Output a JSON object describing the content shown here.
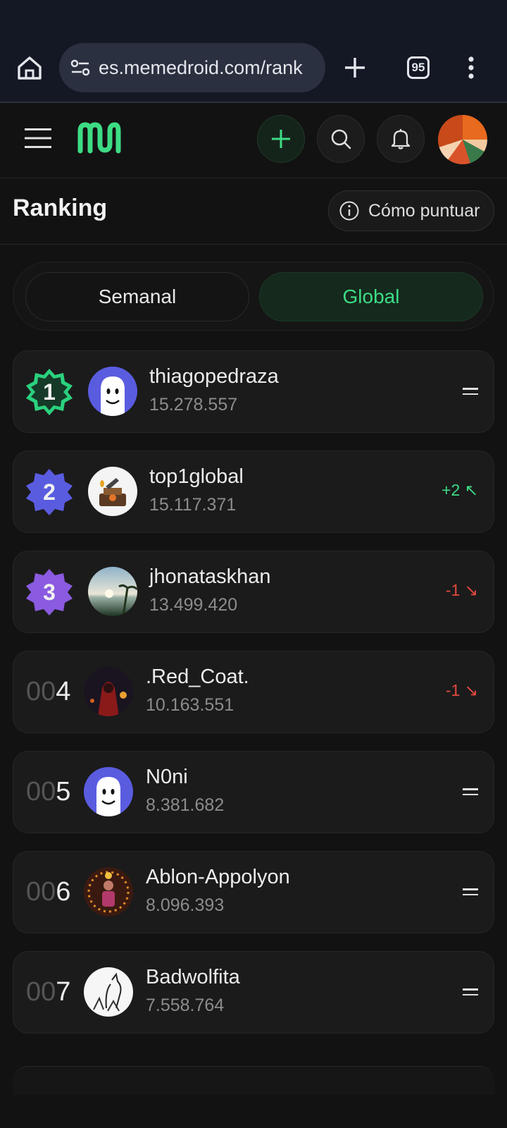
{
  "browser": {
    "url": "es.memedroid.com/rank",
    "tab_count": "95"
  },
  "colors": {
    "accent": "#3ddc84",
    "up": "#3ddc84",
    "down": "#e5483f",
    "gold_badge": "#2bd17e",
    "silver_badge": "#5a5ce0",
    "bronze_badge": "#8a5ae0"
  },
  "header": {
    "icons": [
      "menu-icon",
      "memedroid-logo",
      "plus-icon",
      "search-icon",
      "bell-icon",
      "user-avatar"
    ]
  },
  "page": {
    "title": "Ranking",
    "howto_label": "Cómo puntuar"
  },
  "tabs": {
    "weekly": "Semanal",
    "global": "Global",
    "selected": "Global"
  },
  "ranking": [
    {
      "rank": "1",
      "username": "thiagopedraza",
      "score": "15.278.557",
      "change": "=",
      "trend": "same"
    },
    {
      "rank": "2",
      "username": "top1global",
      "score": "15.117.371",
      "change": "+2 ↖",
      "trend": "up"
    },
    {
      "rank": "3",
      "username": "jhonataskhan",
      "score": "13.499.420",
      "change": "-1 ↘",
      "trend": "down"
    },
    {
      "rank_pad": "00",
      "rank": "4",
      "username": ".Red_Coat.",
      "score": "10.163.551",
      "change": "-1 ↘",
      "trend": "down"
    },
    {
      "rank_pad": "00",
      "rank": "5",
      "username": "N0ni",
      "score": "8.381.682",
      "change": "=",
      "trend": "same"
    },
    {
      "rank_pad": "00",
      "rank": "6",
      "username": "Ablon-Appolyon",
      "score": "8.096.393",
      "change": "=",
      "trend": "same"
    },
    {
      "rank_pad": "00",
      "rank": "7",
      "username": "Badwolfita",
      "score": "7.558.764",
      "change": "=",
      "trend": "same"
    }
  ]
}
